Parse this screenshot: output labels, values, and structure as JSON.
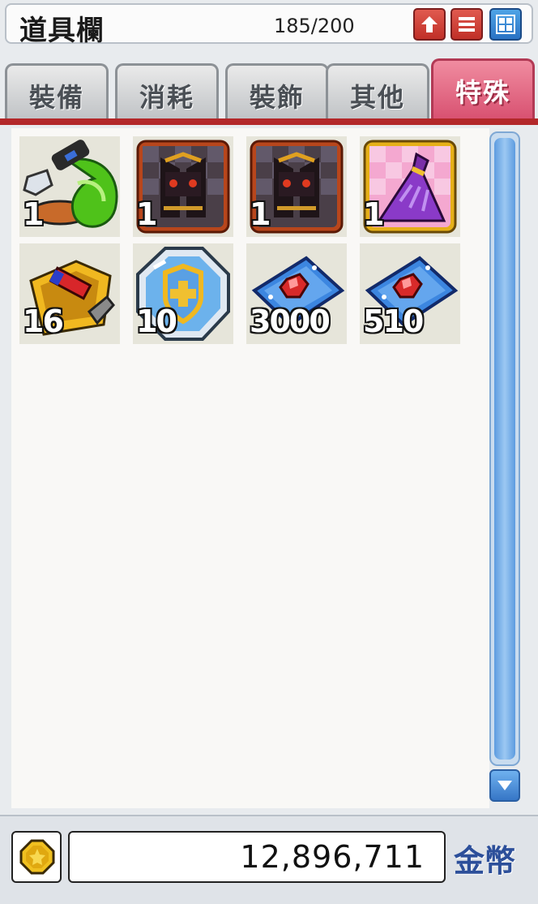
{
  "window": {
    "title": "道具欄",
    "capacity": "185/200"
  },
  "title_buttons": [
    {
      "name": "expand-button",
      "icon": "plus-icon"
    },
    {
      "name": "sort-button",
      "icon": "menu-icon"
    },
    {
      "name": "view-toggle-button",
      "icon": "grid-icon"
    }
  ],
  "tabs": [
    {
      "label": "裝備",
      "active": false
    },
    {
      "label": "消耗",
      "active": false
    },
    {
      "label": "裝飾",
      "active": false
    },
    {
      "label": "其他",
      "active": false
    },
    {
      "label": "特殊",
      "active": true
    }
  ],
  "items": [
    {
      "icon": "pet-food-icon",
      "qty": "1"
    },
    {
      "icon": "dark-armor-box-icon",
      "qty": "1"
    },
    {
      "icon": "dark-armor-box-icon",
      "qty": "1"
    },
    {
      "icon": "purple-dress-icon",
      "qty": "1"
    },
    {
      "icon": "treasure-box-icon",
      "qty": "16"
    },
    {
      "icon": "shield-medal-icon",
      "qty": "10"
    },
    {
      "icon": "red-gem-ticket-icon",
      "qty": "3000"
    },
    {
      "icon": "red-gem-ticket-icon",
      "qty": "510"
    }
  ],
  "footer": {
    "amount": "12,896,711",
    "currency_label": "金幣",
    "coin_icon": "gold-coin-icon"
  },
  "colors": {
    "accent_red": "#b3282a",
    "active_tab": "#d85070",
    "scroll_blue": "#5d9ce0"
  }
}
